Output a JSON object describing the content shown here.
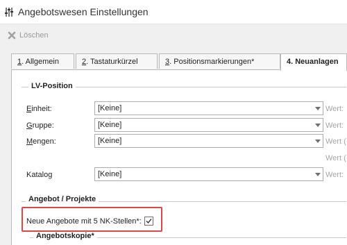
{
  "window": {
    "title": "Angebotswesen Einstellungen",
    "icon": "sliders-icon"
  },
  "toolbar": {
    "delete_label": "Löschen",
    "delete_icon": "x-icon"
  },
  "tabs": [
    {
      "label": "1. Allgemein",
      "active": false
    },
    {
      "label": "2. Tastaturkürzel",
      "active": false
    },
    {
      "label": "3. Positionsmarkierungen*",
      "active": false
    },
    {
      "label": "4. Neuanlagen",
      "active": true
    }
  ],
  "lv_position": {
    "title": "LV-Position",
    "fields": [
      {
        "label": "Einheit:",
        "value": "[Keine]",
        "wert": "Wert:"
      },
      {
        "label": "Gruppe:",
        "value": "[Keine]",
        "wert": "Wert:"
      },
      {
        "label": "Mengen:",
        "value": "[Keine]",
        "wert": "Wert ("
      },
      {
        "label": "Katalog",
        "value": "[Keine]",
        "wert": "Wert:"
      }
    ],
    "extra_wert": "Wert ("
  },
  "angebot_projekte": {
    "title": "Angebot / Projekte",
    "checkbox_label": "Neue Angebote mit 5 NK-Stellen*:",
    "checkbox_checked": true
  },
  "angebotskopie": {
    "title": "Angebotskopie*"
  },
  "colors": {
    "highlight": "#e04545"
  }
}
